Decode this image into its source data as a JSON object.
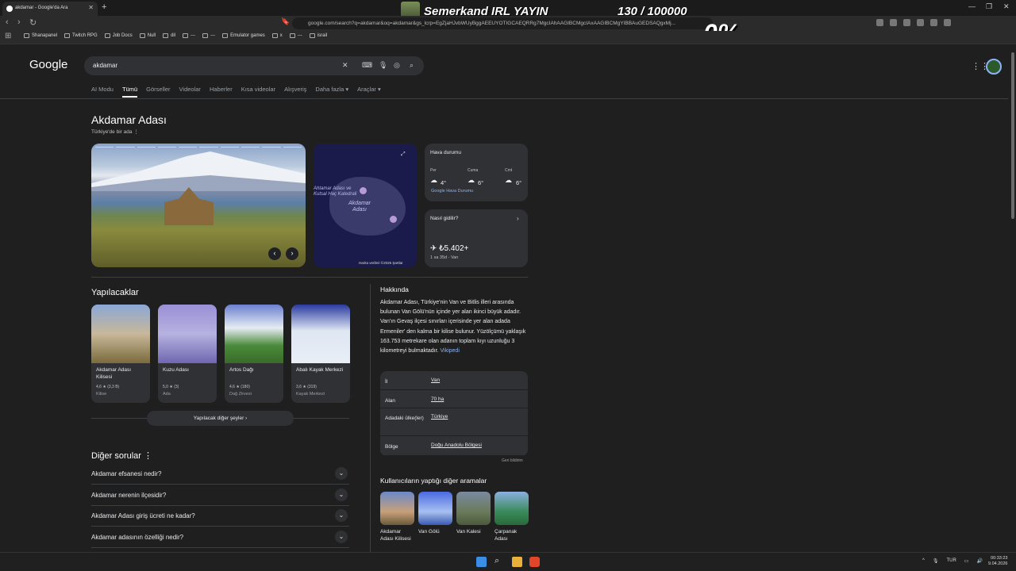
{
  "browser": {
    "tab_title": "akdamar - Google'da Ara",
    "url": "google.com/search?q=akdamar&oq=akdamar&gs_lcrp=EgZjaHJvbWUyBggAEEUYOTIGCAEQRRg7MgcIAhAAGIBCMgcIAxAAGIBCMgYIBBAuGEDSAQgxMj...",
    "bookmarks": [
      "Shanapanel",
      "Twitch RPG",
      "Job Docs",
      "Null",
      "dil",
      "---",
      "---",
      "Emulator games",
      "x",
      "---",
      "israil"
    ]
  },
  "overlay": {
    "channel": "Semerkand IRL YAYIN",
    "counter": "130 / 100000",
    "percent": "0%"
  },
  "google": {
    "logo": "Google",
    "query": "akdamar",
    "tabs": [
      "AI Modu",
      "Tümü",
      "Görseller",
      "Videolar",
      "Haberler",
      "Kısa videolar",
      "Alışveriş",
      "Daha fazla ▾",
      "Araçlar ▾"
    ],
    "kp_title": "Akdamar Adası",
    "kp_subtitle": "Türkiye'de bir ada  ⋮",
    "map": {
      "label1": "Ahtamar Adası ve\nKutsal Haç Katedrali",
      "label2": "Akdamar\nAdası",
      "footer": "Harita verileri ©2026   Şartlar"
    },
    "weather": {
      "title": "Hava durumu",
      "days": [
        {
          "d": "Per",
          "t": "4°"
        },
        {
          "d": "Cuma",
          "t": "6°"
        },
        {
          "d": "Cmt",
          "t": "6°"
        }
      ],
      "source": "Google Hava Durumu"
    },
    "route": {
      "title": "Nasıl gidilir?",
      "price": "✈ ₺5.402+",
      "sub": "1 sa 35d - Van"
    },
    "things_title": "Yapılacaklar",
    "things": [
      {
        "name": "Akdamar Adası Kilisesi",
        "rating": "4,6 ★ (3,3 B)",
        "type": "Kilise"
      },
      {
        "name": "Kuzu Adası",
        "rating": "5,0 ★ (3)",
        "type": "Ada"
      },
      {
        "name": "Artos Dağı",
        "rating": "4,6 ★ (180)",
        "type": "Dağ Zirvesi"
      },
      {
        "name": "Abalı Kayak Merkezi",
        "rating": "3,6 ★ (319)",
        "type": "Kayak Merkezi"
      }
    ],
    "more_things": "Yapılacak diğer şeyler  ›",
    "pq_title": "Diğer sorular  ⋮",
    "questions": [
      "Akdamar efsanesi nedir?",
      "Akdamar nerenin ilçesidir?",
      "Akdamar Adası giriş ücreti ne kadar?",
      "Akdamar adasının özelliği nedir?"
    ],
    "about": {
      "title": "Hakkında",
      "text": "Akdamar Adası, Türkiye'nin Van ve Bitlis illeri arasında bulunan Van Gölü'nün içinde yer alan ikinci büyük adadır. Van'ın Gevaş ilçesi sınırları içerisinde yer alan adada Ermeniler' den kalma bir kilise bulunur. Yüzölçümü yaklaşık 163.753 metrekare olan adanın toplam kıyı uzunluğu 3 kilometreyi bulmaktadır.",
      "link": "Vikipedi",
      "facts": [
        {
          "k": "İl",
          "v": "Van"
        },
        {
          "k": "Alan",
          "v": "70 ha"
        },
        {
          "k": "Adadaki ülke(ler)",
          "v": "Türkiye"
        },
        {
          "k": "Bölge",
          "v": "Doğu Anadolu Bölgesi"
        }
      ],
      "feedback": "Geri bildirim"
    },
    "others_title": "Kullanıcıların yaptığı diğer aramalar",
    "others": [
      "Akdamar Adası Kilisesi",
      "Van Gölü",
      "Van Kalesi",
      "Çarpanak Adası"
    ]
  },
  "taskbar": {
    "lang": "TUR",
    "time": "00:33:23",
    "date": "9.04.2026"
  },
  "colors": {
    "bg": "#1f1f1f",
    "card": "#303134",
    "link": "#8ab4f8"
  }
}
